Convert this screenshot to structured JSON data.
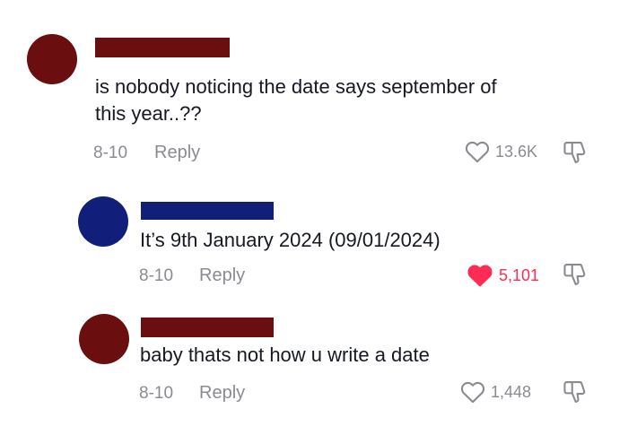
{
  "comments": [
    {
      "name_color": "#6b0e10",
      "avatar_color": "#6b0e10",
      "text_lines": [
        "is nobody noticing the date says september of",
        "this year..??"
      ],
      "date": "8-10",
      "reply_label": "Reply",
      "likes": "13.6K",
      "liked": false
    },
    {
      "name_color": "#111f7a",
      "avatar_color": "#111f7a",
      "text_lines": [
        "It’s 9th January 2024 (09/01/2024)"
      ],
      "date": "8-10",
      "reply_label": "Reply",
      "likes": "5,101",
      "liked": true
    },
    {
      "name_color": "#6b0e10",
      "avatar_color": "#6b0e10",
      "text_lines": [
        "baby thats not how u write a date"
      ],
      "date": "8-10",
      "reply_label": "Reply",
      "likes": "1,448",
      "liked": false
    }
  ],
  "icons": {
    "like": "heart-outline-icon",
    "liked": "heart-filled-icon",
    "dislike": "thumbs-down-icon"
  },
  "colors": {
    "liked": "#fe2c55",
    "muted": "#8a8b91",
    "text": "#161823"
  }
}
